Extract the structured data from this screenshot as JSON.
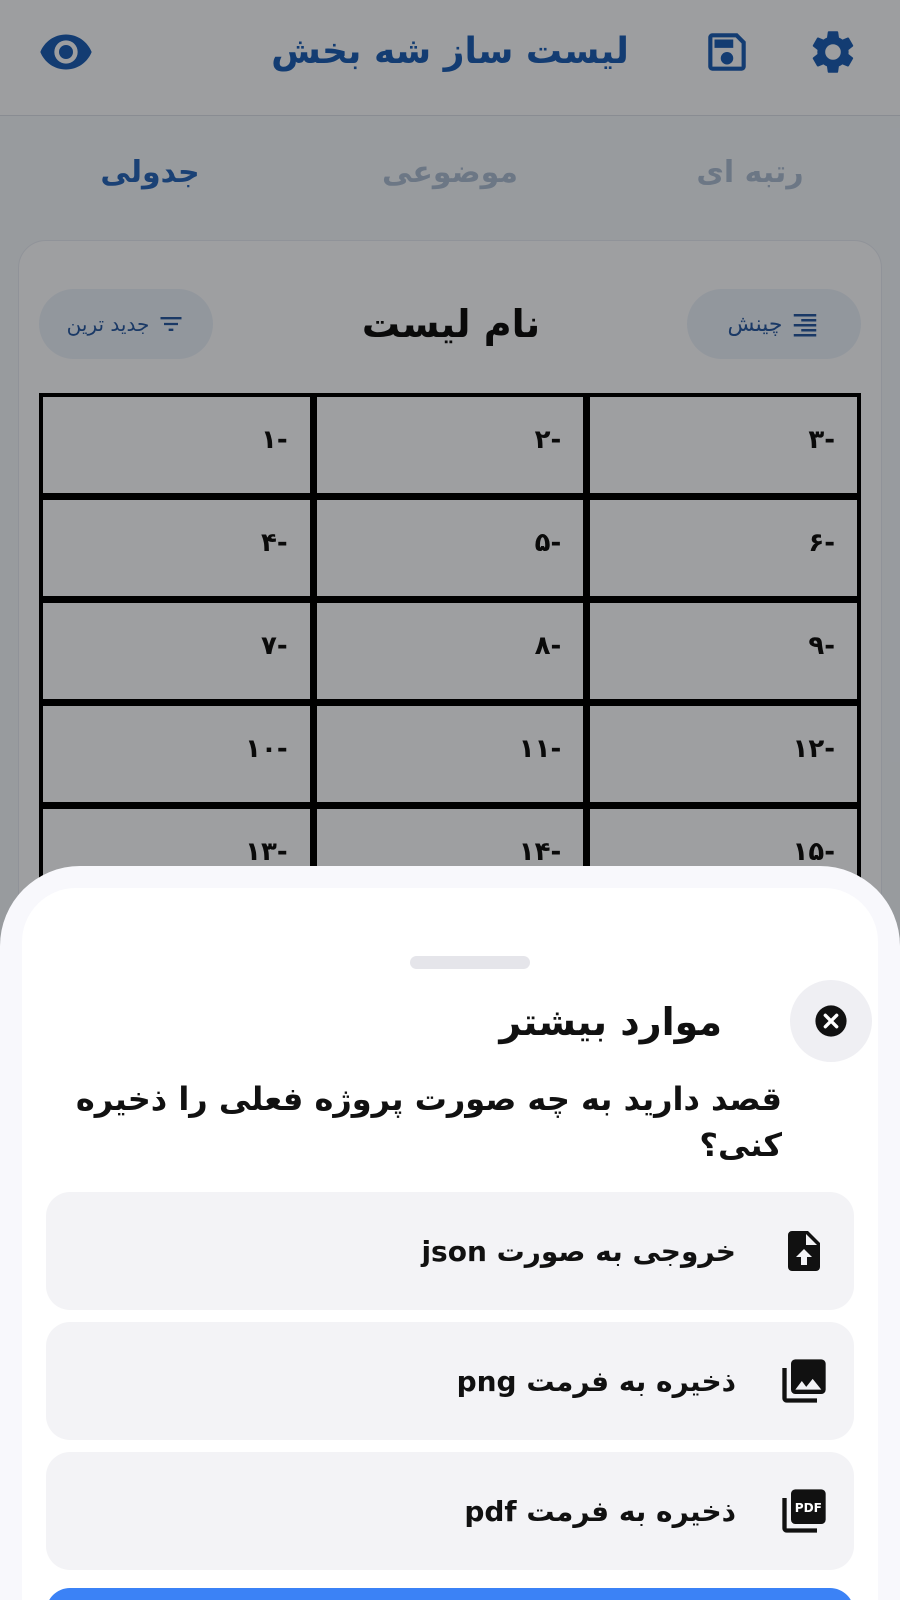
{
  "app": {
    "title": "لیست ساز شه بخش",
    "tabs": [
      "رتبه ای",
      "موضوعی",
      "جدولی"
    ],
    "sort_label": "چینش",
    "filter_label": "جدید ترین",
    "list_name": "نام لیست",
    "cells": [
      "-۳",
      "-۲",
      "-۱",
      "-۶",
      "-۵",
      "-۴",
      "-۹",
      "-۸",
      "-۷",
      "-۱۲",
      "-۱۱",
      "-۱۰",
      "-۱۵",
      "-۱۴",
      "-۱۳"
    ],
    "accent_color": "#1e5fb3"
  },
  "sheet": {
    "title": "موارد بیشتر",
    "question": "قصد دارید به چه صورت پروژه فعلی را ذخیره کنی؟",
    "options": [
      {
        "label": "خروجی به صورت json",
        "icon": "file-upload-icon"
      },
      {
        "label": "ذخیره به فرمت png",
        "icon": "image-collection-icon"
      },
      {
        "label": "ذخیره به فرمت pdf",
        "icon": "pdf-icon"
      }
    ],
    "confirm_color": "#3b82f6"
  }
}
